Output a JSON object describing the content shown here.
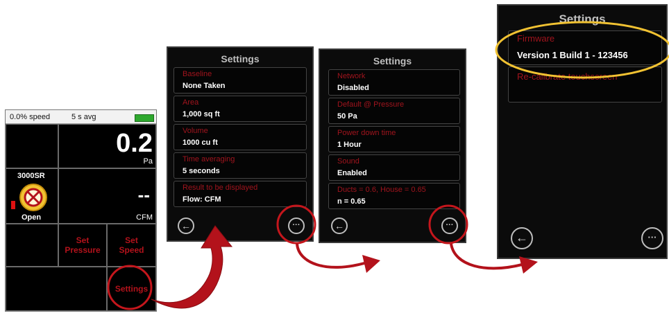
{
  "main_screen": {
    "speed": "0.0% speed",
    "avg": "5 s avg",
    "pressure_value": "0.2",
    "pressure_unit": "Pa",
    "device_name": "3000SR",
    "device_state": "Open",
    "flow_value": "--",
    "flow_unit": "CFM",
    "set_pressure_line1": "Set",
    "set_pressure_line2": "Pressure",
    "set_speed_line1": "Set",
    "set_speed_line2": "Speed",
    "settings_label": "Settings"
  },
  "panels": [
    {
      "title": "Settings",
      "items": [
        {
          "label": "Baseline",
          "value": "None Taken"
        },
        {
          "label": "Area",
          "value": "1,000 sq ft"
        },
        {
          "label": "Volume",
          "value": "1000 cu ft"
        },
        {
          "label": "Time averaging",
          "value": "5 seconds"
        },
        {
          "label": "Result to be displayed",
          "value": "Flow: CFM"
        }
      ]
    },
    {
      "title": "Settings",
      "items": [
        {
          "label": "Network",
          "value": "Disabled"
        },
        {
          "label": "Default @ Pressure",
          "value": "50 Pa"
        },
        {
          "label": "Power down time",
          "value": "1 Hour"
        },
        {
          "label": "Sound",
          "value": "Enabled"
        },
        {
          "label": "Ducts = 0.6, House = 0.65",
          "value": "n = 0.65"
        }
      ]
    },
    {
      "title": "Settings",
      "items": [
        {
          "label": "Firmware",
          "value": "Version 1 Build 1 - 123456"
        },
        {
          "label": "Re-calibrate touchscreen",
          "value": ""
        }
      ]
    }
  ],
  "icons": {
    "back": "←",
    "more": "···"
  },
  "colors": {
    "accent_red": "#b3121b",
    "highlight_yellow": "#f1c232",
    "battery_green": "#2ea82e"
  }
}
